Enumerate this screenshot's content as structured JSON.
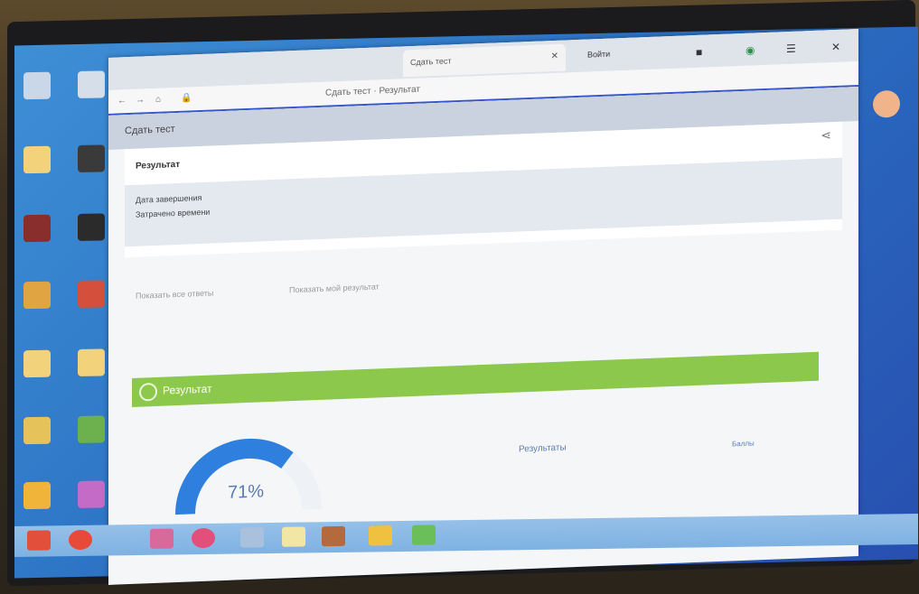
{
  "browser": {
    "tab_title": "Сдать тест",
    "url": "",
    "breadcrumb": "Сдать тест · Результат",
    "toolbar_right": "Войти"
  },
  "page": {
    "header_title": "Сдать тест",
    "result_title": "Результат",
    "meta_line_1": "Дата завершения",
    "meta_line_2": "Затрачено времени",
    "meta_line_3": "",
    "action_1": "Показать все ответы",
    "action_2": "Показать мой результат",
    "section_title": "Результат",
    "score": "71%",
    "score_value": 0.71,
    "table_header_left": "Результаты",
    "table_header_right": "Баллы",
    "rows": [
      {
        "label": "",
        "value": ""
      },
      {
        "label": "",
        "value": ""
      },
      {
        "label": "",
        "value": ""
      }
    ]
  },
  "colors": {
    "accent": "#3656c9",
    "green_bar": "#8cc84b",
    "gauge": "#2f7fde"
  }
}
